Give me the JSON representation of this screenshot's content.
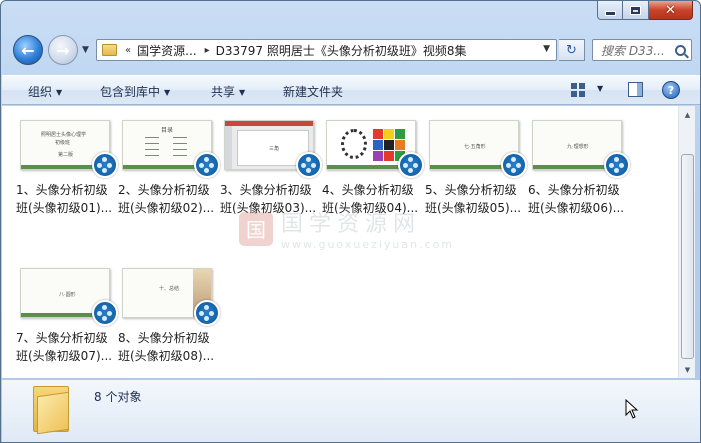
{
  "window": {
    "caption_buttons": {
      "close_glyph": "✕"
    }
  },
  "nav": {
    "back_glyph": "←",
    "forward_glyph": "→",
    "breadcrumb_overflow": "«",
    "crumb_arrow": "▸",
    "breadcrumbs": [
      "国学资源...",
      "D33797 照明居士《头像分析初级班》视频8集"
    ],
    "search_placeholder": "搜索 D33...",
    "refresh_glyph": "↻"
  },
  "toolbar": {
    "organize": "组织",
    "include_library": "包含到库中",
    "share": "共享",
    "new_folder": "新建文件夹",
    "help_glyph": "?"
  },
  "files": [
    {
      "line1": "1、头像分析初级",
      "line2": "班(头像初级01)..."
    },
    {
      "line1": "2、头像分析初级",
      "line2": "班(头像初级02)..."
    },
    {
      "line1": "3、头像分析初级",
      "line2": "班(头像初级03)..."
    },
    {
      "line1": "4、头像分析初级",
      "line2": "班(头像初级04)..."
    },
    {
      "line1": "5、头像分析初级",
      "line2": "班(头像初级05)..."
    },
    {
      "line1": "6、头像分析初级",
      "line2": "班(头像初级06)..."
    },
    {
      "line1": "7、头像分析初级",
      "line2": "班(头像初级07)..."
    },
    {
      "line1": "8、头像分析初级",
      "line2": "班(头像初级08)..."
    }
  ],
  "thumb_titles": {
    "t1a": "照明居士头像心理学",
    "t1b": "初级班",
    "t1c": "第二版",
    "t2": "目录",
    "t3": "三角",
    "t5": "七·五角形",
    "t6": "九·理想形",
    "t7": "八·圆形",
    "t8": "十、总结"
  },
  "status": {
    "count": "8 个对象"
  },
  "watermark": {
    "logo": "国",
    "name": "国学资源网",
    "url": "www.guoxueziyuan.com"
  },
  "colors": {
    "badge": "#1463aa",
    "thumb_accent": "#5c8f4e"
  }
}
